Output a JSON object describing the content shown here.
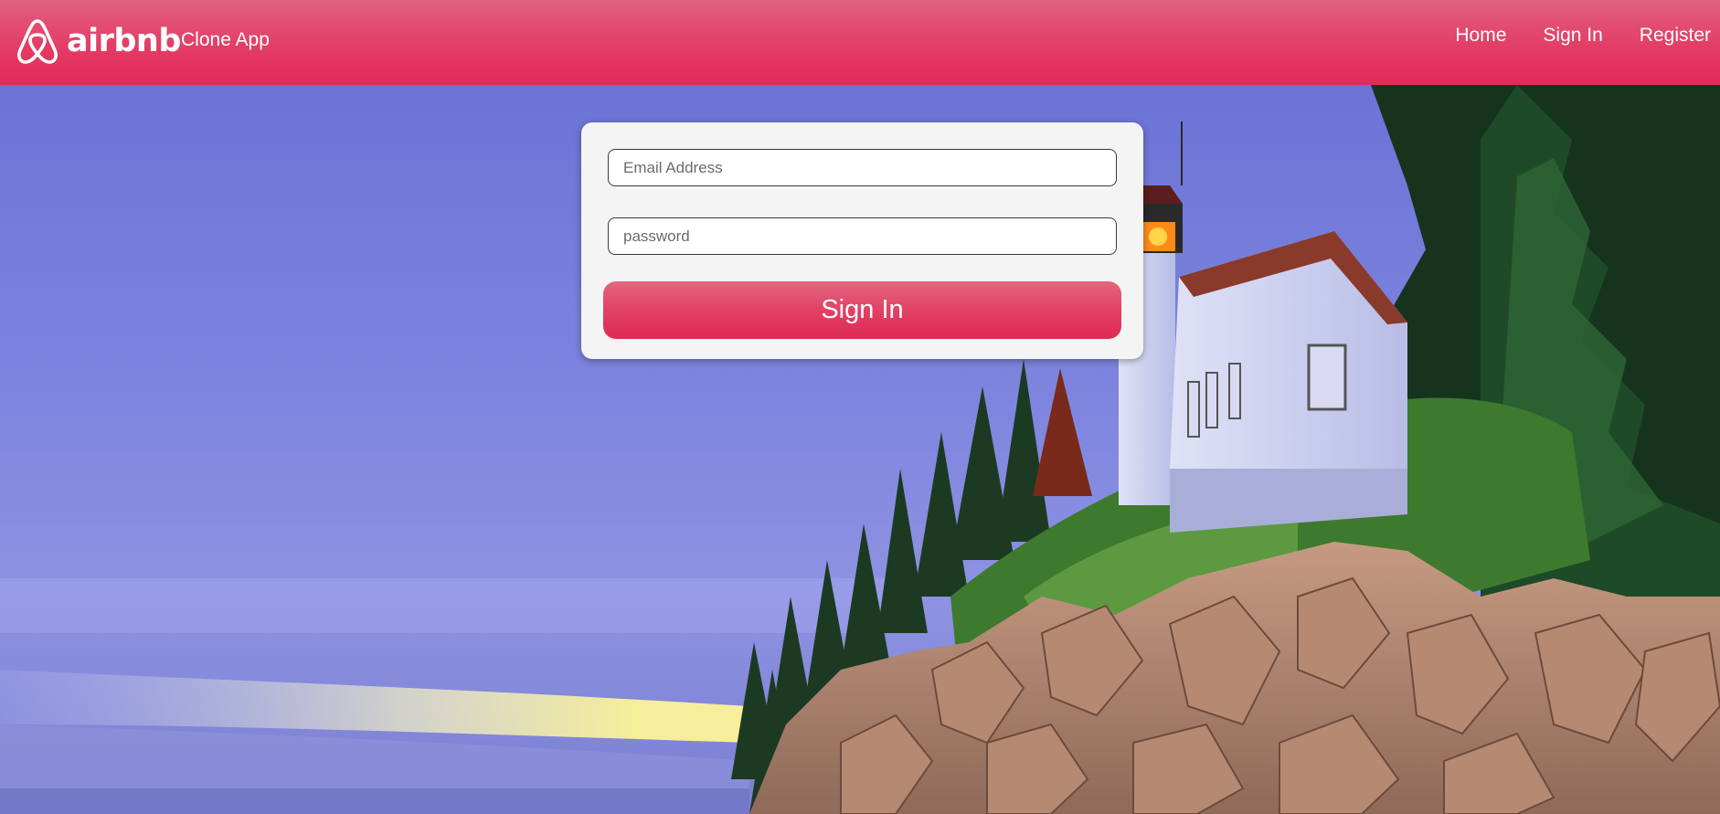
{
  "header": {
    "brand": "airbnb",
    "subtitle": "Clone App",
    "nav": [
      {
        "label": "Home"
      },
      {
        "label": "Sign In"
      },
      {
        "label": "Register"
      }
    ]
  },
  "login": {
    "email_placeholder": "Email Address",
    "password_placeholder": "password",
    "submit_label": "Sign In"
  },
  "colors": {
    "brand": "#e23d62",
    "card": "#f4f4f4"
  },
  "background": {
    "icon": "lighthouse-photo"
  }
}
